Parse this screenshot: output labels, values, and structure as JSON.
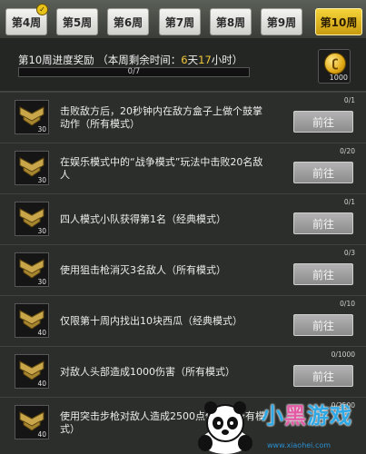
{
  "tabs": [
    {
      "label": "第4周",
      "state": "claimed"
    },
    {
      "label": "第5周",
      "state": "normal"
    },
    {
      "label": "第6周",
      "state": "normal"
    },
    {
      "label": "第7周",
      "state": "normal"
    },
    {
      "label": "第8周",
      "state": "normal"
    },
    {
      "label": "第9周",
      "state": "normal"
    },
    {
      "label": "第10周",
      "state": "active"
    }
  ],
  "header": {
    "title_prefix": "第10周进度奖励 （本周剩余时间：",
    "time_days_value": "6",
    "time_days_unit": "天",
    "time_hours_value": "17",
    "time_hours_unit": "小时）",
    "progress_text": "0/7",
    "progress_fraction": 0,
    "reward_amount": "1000"
  },
  "tasks": [
    {
      "desc": "击败敌方后，20秒钟内在敌方盒子上做个鼓掌动作（所有模式）",
      "progress": "0/1",
      "points": "30",
      "button": "前往"
    },
    {
      "desc": "在娱乐模式中的“战争模式”玩法中击败20名敌人",
      "progress": "0/20",
      "points": "30",
      "button": "前往"
    },
    {
      "desc": "四人模式小队获得第1名（经典模式）",
      "progress": "0/1",
      "points": "30",
      "button": "前往"
    },
    {
      "desc": "使用狙击枪消灭3名敌人（所有模式）",
      "progress": "0/3",
      "points": "30",
      "button": "前往"
    },
    {
      "desc": "仅限第十周内找出10块西瓜（经典模式）",
      "progress": "0/10",
      "points": "40",
      "button": "前往"
    },
    {
      "desc": "对敌人头部造成1000伤害（所有模式）",
      "progress": "0/1000",
      "points": "40",
      "button": "前往"
    },
    {
      "desc": "使用突击步枪对敌人造成2500点伤害（所有模式）",
      "progress": "0/2500",
      "points": "40",
      "button": "前往"
    }
  ],
  "watermark": {
    "text_a": "小",
    "text_b": "黑",
    "text_c": "游戏",
    "url": "www.xiaohei.com"
  },
  "colors": {
    "tab_active": "#e5b820",
    "highlight_gold": "#f1c93a",
    "button_gray": "#9e9e9e"
  },
  "icons": {
    "badge": "chevron-rank-icon",
    "reward": "coin-icon"
  }
}
